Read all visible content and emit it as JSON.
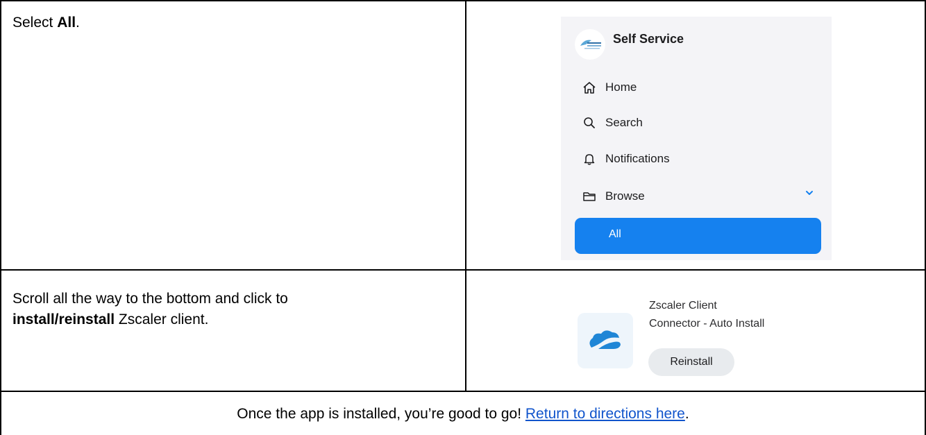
{
  "steps": [
    {
      "text_prefix": "Select ",
      "text_bold": "All",
      "text_suffix": "."
    },
    {
      "text_line1": "Scroll all the way to the bottom and click to",
      "text_bold": "install/reinstall",
      "text_suffix": " Zscaler client."
    }
  ],
  "self_service": {
    "title": "Self Service",
    "nav": [
      {
        "label": "Home",
        "icon": "home-icon"
      },
      {
        "label": "Search",
        "icon": "search-icon"
      },
      {
        "label": "Notifications",
        "icon": "bell-icon"
      },
      {
        "label": "Browse",
        "icon": "folder-icon"
      }
    ],
    "selected_item": "All",
    "accent_color": "#1581ef"
  },
  "app": {
    "name_line1": "Zscaler Client",
    "name_line2": "Connector - Auto Install",
    "button_label": "Reinstall",
    "icon": "zscaler-cloud-icon"
  },
  "footer": {
    "text": "Once the app is installed, you’re good to go! ",
    "link_text": "Return to directions here",
    "suffix": "."
  }
}
